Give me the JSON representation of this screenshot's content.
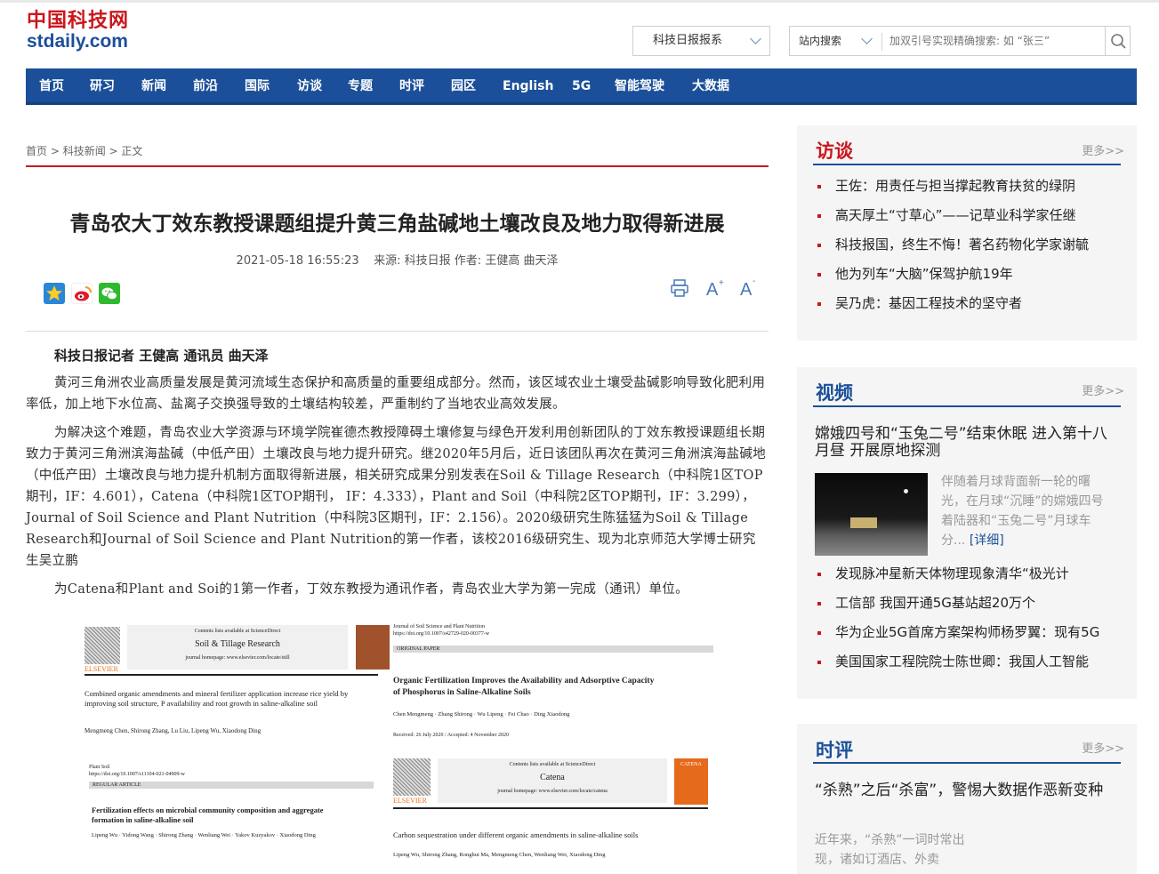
{
  "site": {
    "logo_cn": "中国科技网",
    "logo_en": "stdaily.com"
  },
  "header": {
    "dropdown": "科技日报报系",
    "search_scope": "站内搜索",
    "search_placeholder": "加双引号实现精确搜索: 如 “张三”"
  },
  "nav": [
    "首页",
    "研习",
    "新闻",
    "前沿",
    "国际",
    "访谈",
    "专题",
    "时评",
    "园区",
    "English",
    "5G",
    "智能驾驶",
    "大数据"
  ],
  "breadcrumb": [
    "首页",
    "科技新闻",
    "正文"
  ],
  "article": {
    "title": "青岛农大丁效东教授课题组提升黄三角盐碱地土壤改良及地力取得新进展",
    "datetime": "2021-05-18 16:55:23",
    "source": "来源: 科技日报 作者: 王健高 曲天泽",
    "byline": "科技日报记者 王健高 通讯员 曲天泽",
    "p1": "黄河三角洲农业高质量发展是黄河流域生态保护和高质量的重要组成部分。然而，该区域农业土壤受盐碱影响导致化肥利用率低，加上地下水位高、盐离子交换强导致的土壤结构较差，严重制约了当地农业高效发展。",
    "p2": "为解决这个难题，青岛农业大学资源与环境学院崔德杰教授障碍土壤修复与绿色开发利用创新团队的丁效东教授课题组长期致力于黄河三角洲滨海盐碱（中低产田）土壤改良与地力提升研究。继2020年5月后，近日该团队再次在黄河三角洲滨海盐碱地（中低产田）土壤改良与地力提升机制方面取得新进展，相关研究成果分别发表在Soil & Tillage Research（中科院1区TOP期刊，IF：4.601），Catena（中科院1区TOP期刊， IF：4.333），Plant and Soil（中科院2区TOP期刊，IF：3.299），Journal of Soil Science and Plant Nutrition（中科院3区期刊，IF：2.156）。2020级研究生陈猛猛为Soil & Tillage Research和Journal of Soil Science and Plant Nutrition的第一作者，该校2016级研究生、现为北京师范大学博士研究生吴立鹏",
    "p3": "为Catena和Plant and Soi的1第一作者，丁效东教授为通讯作者，青岛农业大学为第一完成（通讯）单位。"
  },
  "figure": {
    "p1": {
      "journal": "Soil & Tillage Research",
      "contents": "Contents lists available at ScienceDirect",
      "homepage": "journal homepage: www.elsevier.com/locate/still",
      "publisher": "ELSEVIER",
      "title": "Combined organic amendments and mineral fertilizer application increase rice yield by improving soil structure, P availability and root growth in saline-alkaline soil",
      "authors": "Mengmeng Chen, Shirong Zhang, Lu Liu, Lipeng Wu, Xiaodong Ding"
    },
    "p2": {
      "journal": "Journal of Soil Science and Plant Nutrition",
      "doi": "https://doi.org/10.1007/s42729-020-00377-w",
      "tag": "ORIGINAL PAPER",
      "title": "Organic Fertilization Improves the Availability and Adsorptive Capacity of Phosphorus in Saline-Alkaline Soils",
      "authors": "Chen Mengmeng · Zhang Shirong · Wu Lipeng · Fei Chao · Ding Xiaodong",
      "dates": "Received: 26 July 2020 / Accepted: 4 November 2020"
    },
    "p3": {
      "journal": "Plant Soil",
      "doi": "https://doi.org/10.1007/s11104-021-04909-w",
      "tag": "REGULAR ARTICLE",
      "title": "Fertilization effects on microbial community composition and aggregate formation in saline-alkaline soil",
      "authors": "Lipeng Wu · Yidong Wang · Shirong Zhang · Wenliang Wei · Yakov Kuzyakov · Xiaodong Ding"
    },
    "p4": {
      "journal": "Catena",
      "contents": "Contents lists available at ScienceDirect",
      "homepage": "journal homepage: www.elsevier.com/locate/catena",
      "publisher": "ELSEVIER",
      "cover": "CATENA",
      "title": "Carbon sequestration under different organic amendments in saline-alkaline soils",
      "authors": "Lipeng Wu, Shirong Zhang, Ronghui Ma, Mengmeng Chen, Wenliang Wei, Xiaodong Ding"
    }
  },
  "sidebar": {
    "more": "更多>>",
    "interviews": {
      "title": "访谈",
      "items": [
        "王佐：用责任与担当撑起教育扶贫的绿阴",
        "高天厚土“寸草心”——记草业科学家任继",
        "科技报国，终生不悔！著名药物化学家谢毓",
        "他为列车“大脑”保驾护航19年",
        "吴乃虎：基因工程技术的坚守者"
      ]
    },
    "video": {
      "title": "视频",
      "headline": "嫦娥四号和“玉兔二号”结束休眠 进入第十八月昼 开展原地探测",
      "summary": "伴随着月球背面新一轮的曙光，在月球“沉睡”的嫦娥四号着陆器和“玉兔二号”月球车分...",
      "detail": "[详细]",
      "items": [
        "发现脉冲星新天体物理现象清华“极光计",
        "工信部 我国开通5G基站超20万个",
        "华为企业5G首席方案架构师杨罗翼：现有5G",
        "美国国家工程院院士陈世卿：我国人工智能"
      ]
    },
    "commentary": {
      "title": "时评",
      "headline": "“杀熟”之后“杀富”，警惕大数据作恶新变种",
      "summary": "近年来，“杀熟”一词时常出现，诸如订酒店、外卖"
    }
  }
}
